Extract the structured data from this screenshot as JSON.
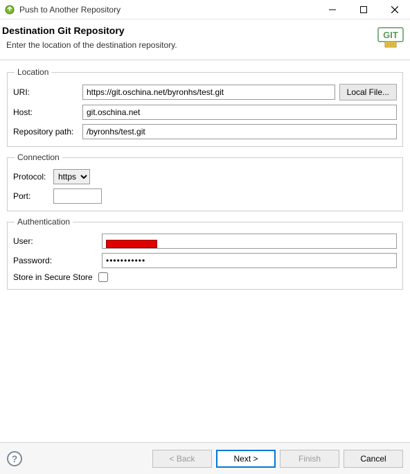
{
  "window": {
    "title": "Push to Another Repository"
  },
  "header": {
    "title": "Destination Git Repository",
    "subtitle": "Enter the location of the destination repository.",
    "badge_text": "GIT"
  },
  "location": {
    "legend": "Location",
    "uri_label": "URI:",
    "uri_value": "https://git.oschina.net/byronhs/test.git",
    "local_file_label": "Local File...",
    "host_label": "Host:",
    "host_value": "git.oschina.net",
    "repo_label": "Repository path:",
    "repo_value": "/byronhs/test.git"
  },
  "connection": {
    "legend": "Connection",
    "protocol_label": "Protocol:",
    "protocol_value": "https",
    "port_label": "Port:",
    "port_value": ""
  },
  "auth": {
    "legend": "Authentication",
    "user_label": "User:",
    "user_value": "",
    "password_label": "Password:",
    "password_value": "•••••••••••",
    "store_label": "Store in Secure Store",
    "store_checked": false
  },
  "footer": {
    "back": "< Back",
    "next": "Next >",
    "finish": "Finish",
    "cancel": "Cancel"
  }
}
